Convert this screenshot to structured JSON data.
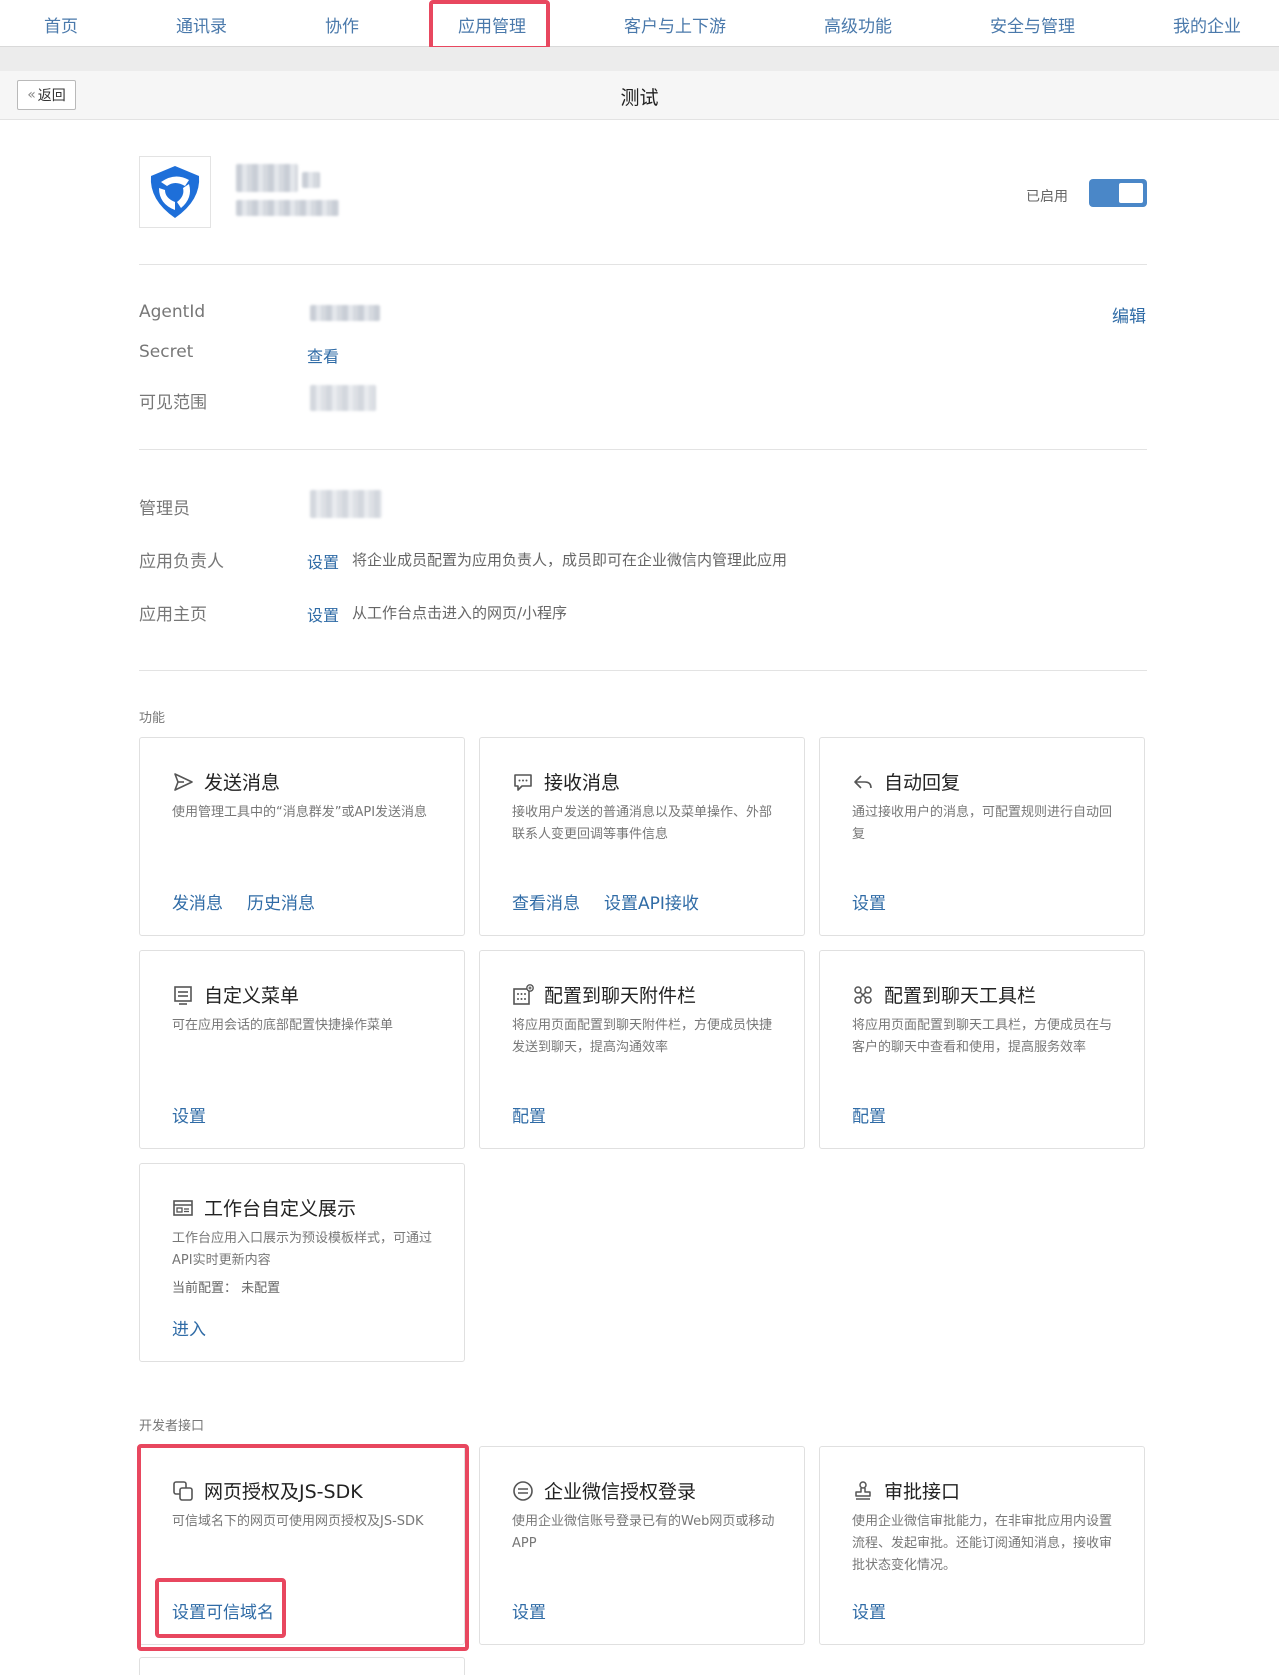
{
  "nav": {
    "items": [
      "首页",
      "通讯录",
      "协作",
      "应用管理",
      "客户与上下游",
      "高级功能",
      "安全与管理",
      "我的企业"
    ]
  },
  "titlebar": {
    "back": "返回",
    "title": "测试"
  },
  "app": {
    "status_label": "已启用"
  },
  "details": {
    "agentid_label": "AgentId",
    "secret_label": "Secret",
    "secret_link": "查看",
    "visible_label": "可见范围",
    "edit": "编辑"
  },
  "management": {
    "admin_label": "管理员",
    "owner_label": "应用负责人",
    "owner_link": "设置",
    "owner_desc": "将企业成员配置为应用负责人，成员即可在企业微信内管理此应用",
    "home_label": "应用主页",
    "home_link": "设置",
    "home_desc": "从工作台点击进入的网页/小程序"
  },
  "features": {
    "title": "功能",
    "cards": [
      {
        "title": "发送消息",
        "icon": "send-icon",
        "desc": "使用管理工具中的“消息群发”或API发送消息",
        "links": [
          "发消息",
          "历史消息"
        ]
      },
      {
        "title": "接收消息",
        "icon": "chat-icon",
        "desc": "接收用户发送的普通消息以及菜单操作、外部联系人变更回调等事件信息",
        "links": [
          "查看消息",
          "设置API接收"
        ]
      },
      {
        "title": "自动回复",
        "icon": "reply-icon",
        "desc": "通过接收用户的消息，可配置规则进行自动回复",
        "links": [
          "设置"
        ]
      },
      {
        "title": "自定义菜单",
        "icon": "menu-icon",
        "desc": "可在应用会话的底部配置快捷操作菜单",
        "links": [
          "设置"
        ]
      },
      {
        "title": "配置到聊天附件栏",
        "icon": "attachment-grid-icon",
        "desc": "将应用页面配置到聊天附件栏，方便成员快捷发送到聊天，提高沟通效率",
        "links": [
          "配置"
        ]
      },
      {
        "title": "配置到聊天工具栏",
        "icon": "toolbar-icon",
        "desc": "将应用页面配置到聊天工具栏，方便成员在与客户的聊天中查看和使用，提高服务效率",
        "links": [
          "配置"
        ]
      },
      {
        "title": "工作台自定义展示",
        "icon": "workbench-icon",
        "desc": "工作台应用入口展示为预设模板样式，可通过API实时更新内容",
        "sub": "当前配置： 未配置",
        "links": [
          "进入"
        ]
      }
    ]
  },
  "developer": {
    "title": "开发者接口",
    "cards": [
      {
        "title": "网页授权及JS-SDK",
        "icon": "web-auth-icon",
        "desc": "可信域名下的网页可使用网页授权及JS-SDK",
        "links": [
          "设置可信域名"
        ]
      },
      {
        "title": "企业微信授权登录",
        "icon": "login-icon",
        "desc": "使用企业微信账号登录已有的Web网页或移动APP",
        "links": [
          "设置"
        ]
      },
      {
        "title": "审批接口",
        "icon": "approval-icon",
        "desc": "使用企业微信审批能力，在非审批应用内设置流程、发起审批。还能订阅通知消息，接收审批状态变化情况。",
        "links": [
          "设置"
        ]
      }
    ]
  }
}
